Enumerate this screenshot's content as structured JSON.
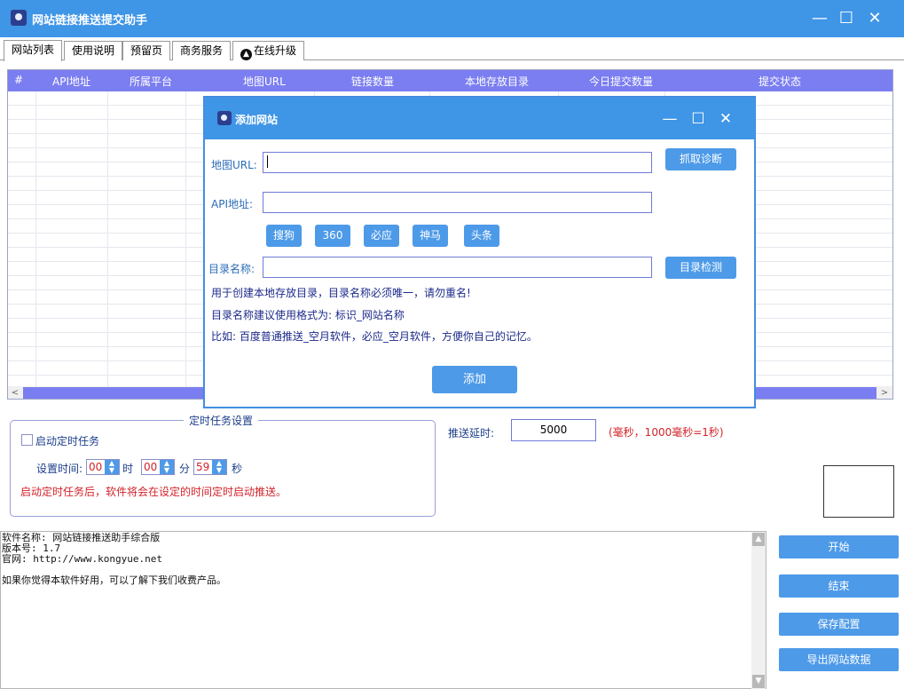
{
  "window": {
    "title": "网站链接推送提交助手",
    "minimize_glyph": "—",
    "maximize_glyph": "☐",
    "close_glyph": "✕"
  },
  "tabs": [
    {
      "label": "网站列表",
      "active": true
    },
    {
      "label": "使用说明",
      "active": false
    },
    {
      "label": "预留页",
      "active": false
    },
    {
      "label": "商务服务",
      "active": false
    },
    {
      "label": "在线升级",
      "active": false,
      "icon": "upload-arrow-icon"
    }
  ],
  "grid": {
    "columns": [
      "#",
      "API地址",
      "所属平台",
      "地图URL",
      "链接数量",
      "本地存放目录",
      "今日提交数量",
      "提交状态"
    ],
    "rows": [],
    "header_color": "#7b7ef0"
  },
  "dialog": {
    "title": "添加网站",
    "sitemap_label": "地图URL:",
    "sitemap_value": "",
    "diagnose_button": "抓取诊断",
    "api_label": "API地址:",
    "api_value": "",
    "engine_buttons": [
      "搜狗",
      "360",
      "必应",
      "神马",
      "头条"
    ],
    "dir_label": "目录名称:",
    "dir_value": "",
    "dir_check_button": "目录检测",
    "notes": [
      "用于创建本地存放目录，目录名称必须唯一，请勿重名!",
      "目录名称建议使用格式为: 标识_网站名称",
      "比如:  百度普通推送_空月软件，必应_空月软件，方便你自己的记忆。"
    ],
    "add_button": "添加"
  },
  "schedule": {
    "legend": "定时任务设置",
    "enable_label": "启动定时任务",
    "enabled": false,
    "time_label": "设置时间:",
    "hour": "00",
    "hour_unit": "时",
    "minute": "00",
    "minute_unit": "分",
    "second": "59",
    "second_unit": "秒",
    "warning": "启动定时任务后，软件将会在设定的时间定时启动推送。"
  },
  "delay": {
    "label": "推送延时:",
    "value": "5000",
    "hint": "(毫秒，1000毫秒=1秒)"
  },
  "log_lines": [
    "软件名称: 网站链接推送助手综合版",
    "版本号: 1.7",
    "官网: http://www.kongyue.net",
    "",
    "如果你觉得本软件好用，可以了解下我们收费产品。"
  ],
  "actions": {
    "start": "开始",
    "stop": "结束",
    "save": "保存配置",
    "export": "导出网站数据"
  },
  "colors": {
    "titlebar": "#3f95e6",
    "button": "#4d9ae8",
    "warning_text": "#d2232a"
  }
}
